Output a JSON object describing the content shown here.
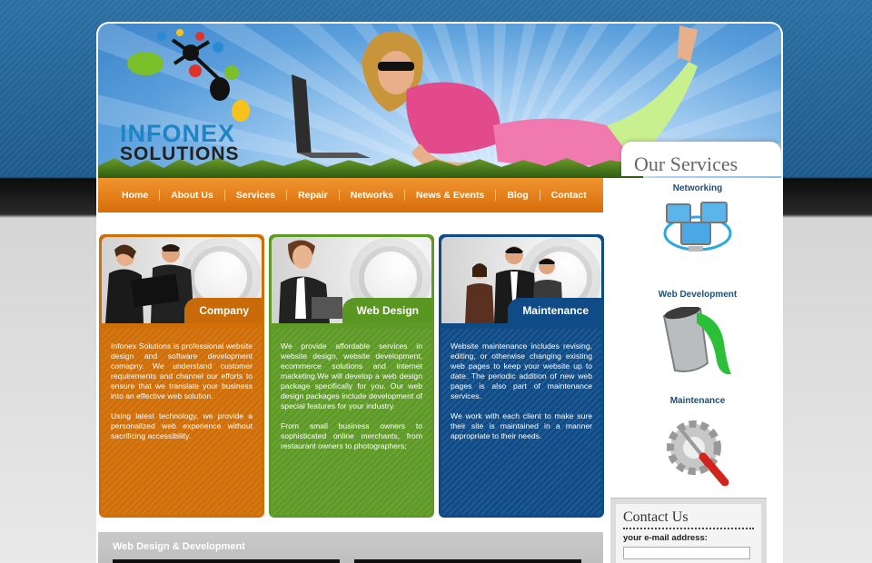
{
  "brand": {
    "line1": "INFONEX",
    "line2": "SOLUTIONS"
  },
  "nav": [
    "Home",
    "About Us",
    "Services",
    "Repair",
    "Networks",
    "News & Events",
    "Blog",
    "Contact"
  ],
  "sidebar": {
    "title": "Our Services",
    "items": [
      {
        "label": "Networking",
        "icon": "networking-icon"
      },
      {
        "label": "Web Development",
        "icon": "paint-bucket-icon"
      },
      {
        "label": "Maintenance",
        "icon": "gear-screwdriver-icon"
      }
    ]
  },
  "cards": [
    {
      "title": "Company",
      "color": "#d06e08",
      "paragraphs": [
        "Infonex Solutions is professional website design and software development comapny. We understand customer requirements and channel our efforts to ensure that we translate your business into an effective web solution.",
        "Using latest technology, we provide a personalized web experience without sacrificing accessibility."
      ]
    },
    {
      "title": "Web Design",
      "color": "#5e9a26",
      "paragraphs": [
        "We provide affordable services in website design, website development, ecommerce solutions and internet marketing.We will develop a web design package specifically for you. Our web design packages include development of special features for your industry.",
        "From small business owners to sophisticated online merchants, from restaurant owners to photographers;"
      ]
    },
    {
      "title": "Maintenance",
      "color": "#0e4b87",
      "paragraphs": [
        "Website maintenance includes revising, editing, or otherwise changing existing web pages to keep your website up to date. The periodic addition of new web pages is also part of maintenance services.",
        "We work with each client to make sure their site is maintained in a manner appropriate to their needs."
      ]
    }
  ],
  "bottom": {
    "heading": "Web Design & Development"
  },
  "contact": {
    "title": "Contact Us",
    "email_label": "your e-mail address:",
    "email_value": ""
  }
}
